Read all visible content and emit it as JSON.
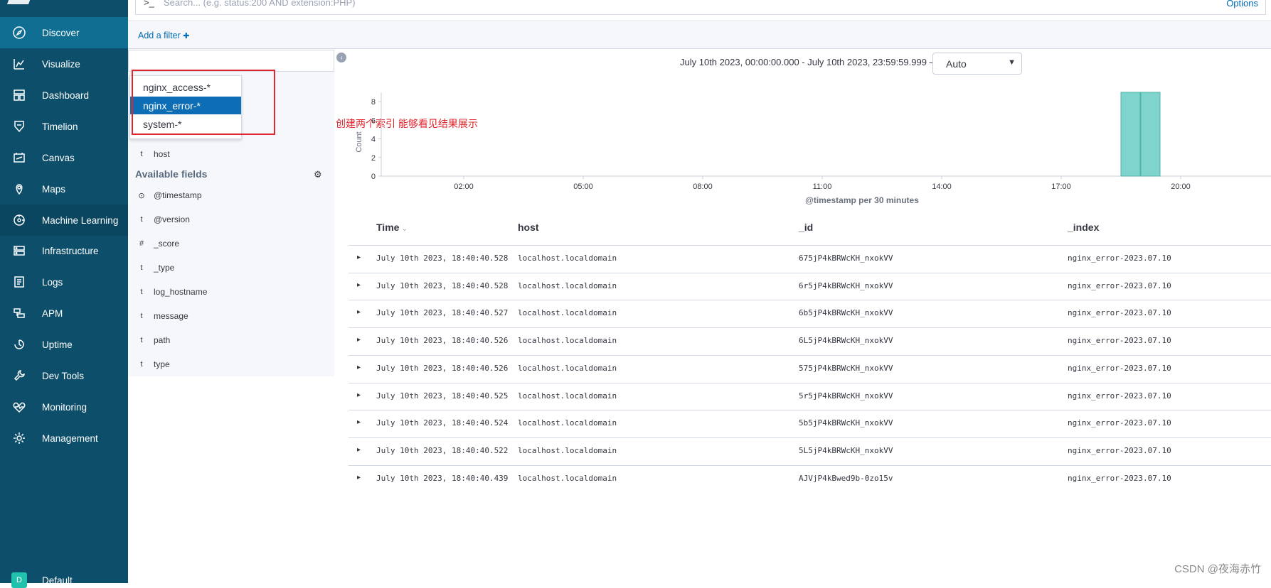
{
  "sidebar": {
    "items": [
      {
        "label": "Discover",
        "icon": "compass-icon"
      },
      {
        "label": "Visualize",
        "icon": "chart-icon"
      },
      {
        "label": "Dashboard",
        "icon": "dashboard-icon"
      },
      {
        "label": "Timelion",
        "icon": "shield-icon"
      },
      {
        "label": "Canvas",
        "icon": "canvas-icon"
      },
      {
        "label": "Maps",
        "icon": "map-pin-icon"
      },
      {
        "label": "Machine Learning",
        "icon": "ml-icon"
      },
      {
        "label": "Infrastructure",
        "icon": "infra-icon"
      },
      {
        "label": "Logs",
        "icon": "logs-icon"
      },
      {
        "label": "APM",
        "icon": "apm-icon"
      },
      {
        "label": "Uptime",
        "icon": "uptime-icon"
      },
      {
        "label": "Dev Tools",
        "icon": "wrench-icon"
      },
      {
        "label": "Monitoring",
        "icon": "heartbeat-icon"
      },
      {
        "label": "Management",
        "icon": "gear-icon"
      }
    ],
    "space_initial": "D",
    "space_label": "Default"
  },
  "query": {
    "prompt": ">_",
    "placeholder": "Search... (e.g. status:200 AND extension:PHP)",
    "options": "Options"
  },
  "filter": {
    "add_label": "Add a filter",
    "add_icon": "✚"
  },
  "index_dropdown": {
    "items": [
      "nginx_access-*",
      "nginx_error-*",
      "system-*"
    ],
    "selected": "nginx_error-*"
  },
  "annotation": "创建两个索引   能够看见结果展示",
  "fields": {
    "selected": [
      {
        "type": "t",
        "name": "host"
      }
    ],
    "available_title": "Available fields",
    "available": [
      {
        "type": "⊙",
        "name": "@timestamp"
      },
      {
        "type": "t",
        "name": "@version"
      },
      {
        "type": "#",
        "name": "_score"
      },
      {
        "type": "t",
        "name": "_type"
      },
      {
        "type": "t",
        "name": "log_hostname"
      },
      {
        "type": "t",
        "name": "message"
      },
      {
        "type": "t",
        "name": "path"
      },
      {
        "type": "t",
        "name": "type"
      }
    ]
  },
  "time_range": "July 10th 2023, 00:00:00.000 - July 10th 2023, 23:59:59.999 —",
  "interval": "Auto",
  "chart_data": {
    "type": "bar",
    "x_ticks": [
      "02:00",
      "05:00",
      "08:00",
      "11:00",
      "14:00",
      "17:00",
      "20:00"
    ],
    "y_ticks": [
      0,
      2,
      4,
      6,
      8
    ],
    "ylabel": "Count",
    "xlabel": "@timestamp per 30 minutes",
    "bars": [
      {
        "x": "18:30",
        "value": 9
      },
      {
        "x": "19:00",
        "value": 9
      }
    ],
    "ylim": [
      0,
      9
    ],
    "bar_color": "#7fd4cd"
  },
  "table": {
    "headers": [
      "Time",
      "host",
      "_id",
      "_index"
    ],
    "sort_indicator": "⌄",
    "rows": [
      [
        "July 10th 2023, 18:40:40.528",
        "localhost.localdomain",
        "675jP4kBRWcKH_nxokVV",
        "nginx_error-2023.07.10"
      ],
      [
        "July 10th 2023, 18:40:40.528",
        "localhost.localdomain",
        "6r5jP4kBRWcKH_nxokVV",
        "nginx_error-2023.07.10"
      ],
      [
        "July 10th 2023, 18:40:40.527",
        "localhost.localdomain",
        "6b5jP4kBRWcKH_nxokVV",
        "nginx_error-2023.07.10"
      ],
      [
        "July 10th 2023, 18:40:40.526",
        "localhost.localdomain",
        "6L5jP4kBRWcKH_nxokVV",
        "nginx_error-2023.07.10"
      ],
      [
        "July 10th 2023, 18:40:40.526",
        "localhost.localdomain",
        "575jP4kBRWcKH_nxokVV",
        "nginx_error-2023.07.10"
      ],
      [
        "July 10th 2023, 18:40:40.525",
        "localhost.localdomain",
        "5r5jP4kBRWcKH_nxokVV",
        "nginx_error-2023.07.10"
      ],
      [
        "July 10th 2023, 18:40:40.524",
        "localhost.localdomain",
        "5b5jP4kBRWcKH_nxokVV",
        "nginx_error-2023.07.10"
      ],
      [
        "July 10th 2023, 18:40:40.522",
        "localhost.localdomain",
        "5L5jP4kBRWcKH_nxokVV",
        "nginx_error-2023.07.10"
      ],
      [
        "July 10th 2023, 18:40:40.439",
        "localhost.localdomain",
        "AJVjP4kBwed9b-0zo15v",
        "nginx_error-2023.07.10"
      ]
    ]
  },
  "watermark": "CSDN @夜海赤竹"
}
